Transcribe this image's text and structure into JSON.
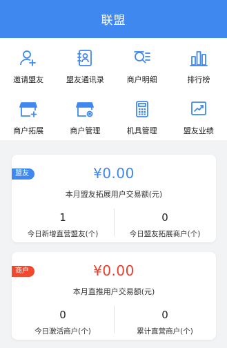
{
  "header": {
    "title": "联盟"
  },
  "colors": {
    "primary": "#3f88f0",
    "accent_red": "#e8412f"
  },
  "menu": [
    {
      "label": "邀请盟友",
      "icon": "invite-user-icon"
    },
    {
      "label": "盟友通讯录",
      "icon": "contact-book-icon"
    },
    {
      "label": "商户明细",
      "icon": "merchant-detail-icon"
    },
    {
      "label": "排行榜",
      "icon": "bar-chart-icon"
    },
    {
      "label": "商户拓展",
      "icon": "store-add-icon"
    },
    {
      "label": "商户管理",
      "icon": "store-settings-icon"
    },
    {
      "label": "机具管理",
      "icon": "calculator-icon"
    },
    {
      "label": "盟友业绩",
      "icon": "trend-chart-icon"
    }
  ],
  "ally_card": {
    "tag": "盟友",
    "amount": "¥0.00",
    "amount_label": "本月盟友拓展用户交易额(元)",
    "stats": [
      {
        "value": "1",
        "label": "今日新增直营盟友(个)"
      },
      {
        "value": "0",
        "label": "今日盟友拓展商户(个)"
      }
    ]
  },
  "merchant_card": {
    "tag": "商户",
    "amount": "¥0.00",
    "amount_label": "本月直推用户交易额(元)",
    "stats": [
      {
        "value": "0",
        "label": "今日激活商户(个)"
      },
      {
        "value": "0",
        "label": "累计直营商户(个)"
      }
    ]
  }
}
